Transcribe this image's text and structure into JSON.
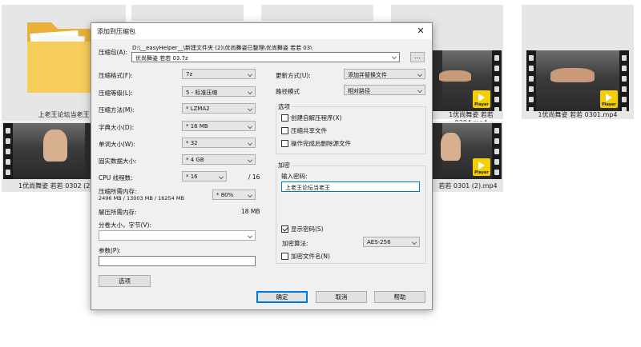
{
  "background": {
    "tiles": [
      {
        "label": "上老王论坛当老王"
      },
      {
        "label": ""
      },
      {
        "label": ""
      },
      {
        "label": "1优尚舞姿 若若 0304.mp4"
      },
      {
        "label": "1优尚舞姿 若若 0301.mp4"
      },
      {
        "label": "1优尚舞姿 若若 0302 (2).mp4"
      },
      {
        "label": "若若 0301 (2).mp4"
      }
    ],
    "player_badge": "Player"
  },
  "dialog": {
    "title": "添加到压缩包",
    "close_symbol": "✕",
    "archive_label": "压缩包(A):",
    "archive_path": "D:\\__easyHelper__\\新建文件夹 (2)\\优尚舞姿已整理\\优尚舞姿 若若 03\\",
    "archive_name": "优尚舞姿 若若 03.7z",
    "browse_label": "...",
    "left": {
      "format_label": "压缩格式(F):",
      "format_value": "7z",
      "level_label": "压缩等级(L):",
      "level_value": "5 - 标准压缩",
      "method_label": "压缩方法(M):",
      "method_value": "* LZMA2",
      "dict_label": "字典大小(D):",
      "dict_value": "* 16 MB",
      "word_label": "单词大小(W):",
      "word_value": "* 32",
      "solid_label": "固实数据大小:",
      "solid_value": "* 4 GB",
      "threads_label": "CPU 线程数:",
      "threads_value": "* 16",
      "threads_max": "/ 16",
      "mem_comp_label": "压缩所需内存:",
      "mem_comp_value": "2496 MB / 13003 MB / 16254 MB",
      "mem_percent": "* 80%",
      "mem_decomp_label": "解压所需内存:",
      "mem_decomp_value": "18 MB",
      "split_label": "分卷大小，字节(V):",
      "split_value": "",
      "params_label": "参数(P):",
      "params_value": "",
      "options_button": "选项"
    },
    "right": {
      "update_label": "更新方式(U):",
      "update_value": "添加并替换文件",
      "path_label": "路径模式",
      "path_value": "相对路径",
      "options_group": "选项",
      "opt_sfx": "创建自解压程序(X)",
      "opt_shared": "压缩共享文件",
      "opt_delete": "操作完成后删除源文件",
      "encrypt_group": "加密",
      "password_label": "输入密码:",
      "password_value": "上老王论坛当老王",
      "show_password": "显示密码(S)",
      "method_label": "加密算法:",
      "method_value": "AES-256",
      "encrypt_names": "加密文件名(N)"
    },
    "buttons": {
      "ok": "确定",
      "cancel": "取消",
      "help": "帮助"
    }
  }
}
